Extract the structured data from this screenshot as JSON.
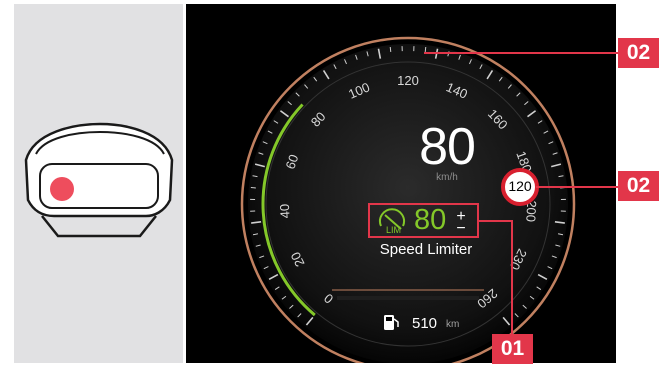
{
  "speedometer": {
    "current_speed": "80",
    "unit": "km/h",
    "scale_labels": [
      "0",
      "20",
      "40",
      "60",
      "80",
      "100",
      "120",
      "140",
      "160",
      "180",
      "200",
      "230",
      "260"
    ],
    "red_zone_label": "0"
  },
  "speed_limiter": {
    "set_speed": "80",
    "increase_symbol": "+",
    "decrease_symbol": "−",
    "label": "Speed Limiter",
    "icon": "speed-limiter-lim-icon"
  },
  "road_sign": {
    "value": "120"
  },
  "fuel": {
    "range_value": "510",
    "unit": "km",
    "icon": "fuel-pump-icon"
  },
  "callouts": {
    "top": "02",
    "right": "02",
    "bottom": "01"
  },
  "thumbnail": {
    "icon": "instrument-cluster-icon"
  },
  "colors": {
    "callout": "#e2364a",
    "limiter_green": "#84c829",
    "gauge_ring": "#c08060",
    "background": "#000000"
  }
}
